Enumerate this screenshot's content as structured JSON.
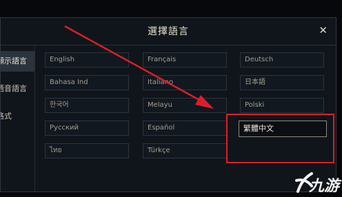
{
  "dialog": {
    "title": "選擇語言",
    "close_label": "✕"
  },
  "sidebar": {
    "items": [
      {
        "label": "顯示語言",
        "active": true
      },
      {
        "label": "語音語言",
        "active": false
      },
      {
        "label": "格式",
        "active": false
      }
    ]
  },
  "languages": [
    "English",
    "Français",
    "Deutsch",
    "Bahasa Ind",
    "Italiano",
    "日本語",
    "한국어",
    "Melayu",
    "Polski",
    "Русский",
    "Español",
    "繁體中文",
    "ไทย",
    "Türkçe"
  ],
  "selected_language": "繁體中文",
  "annotation": {
    "color": "#d9202a"
  },
  "watermark": {
    "text": "九游"
  }
}
